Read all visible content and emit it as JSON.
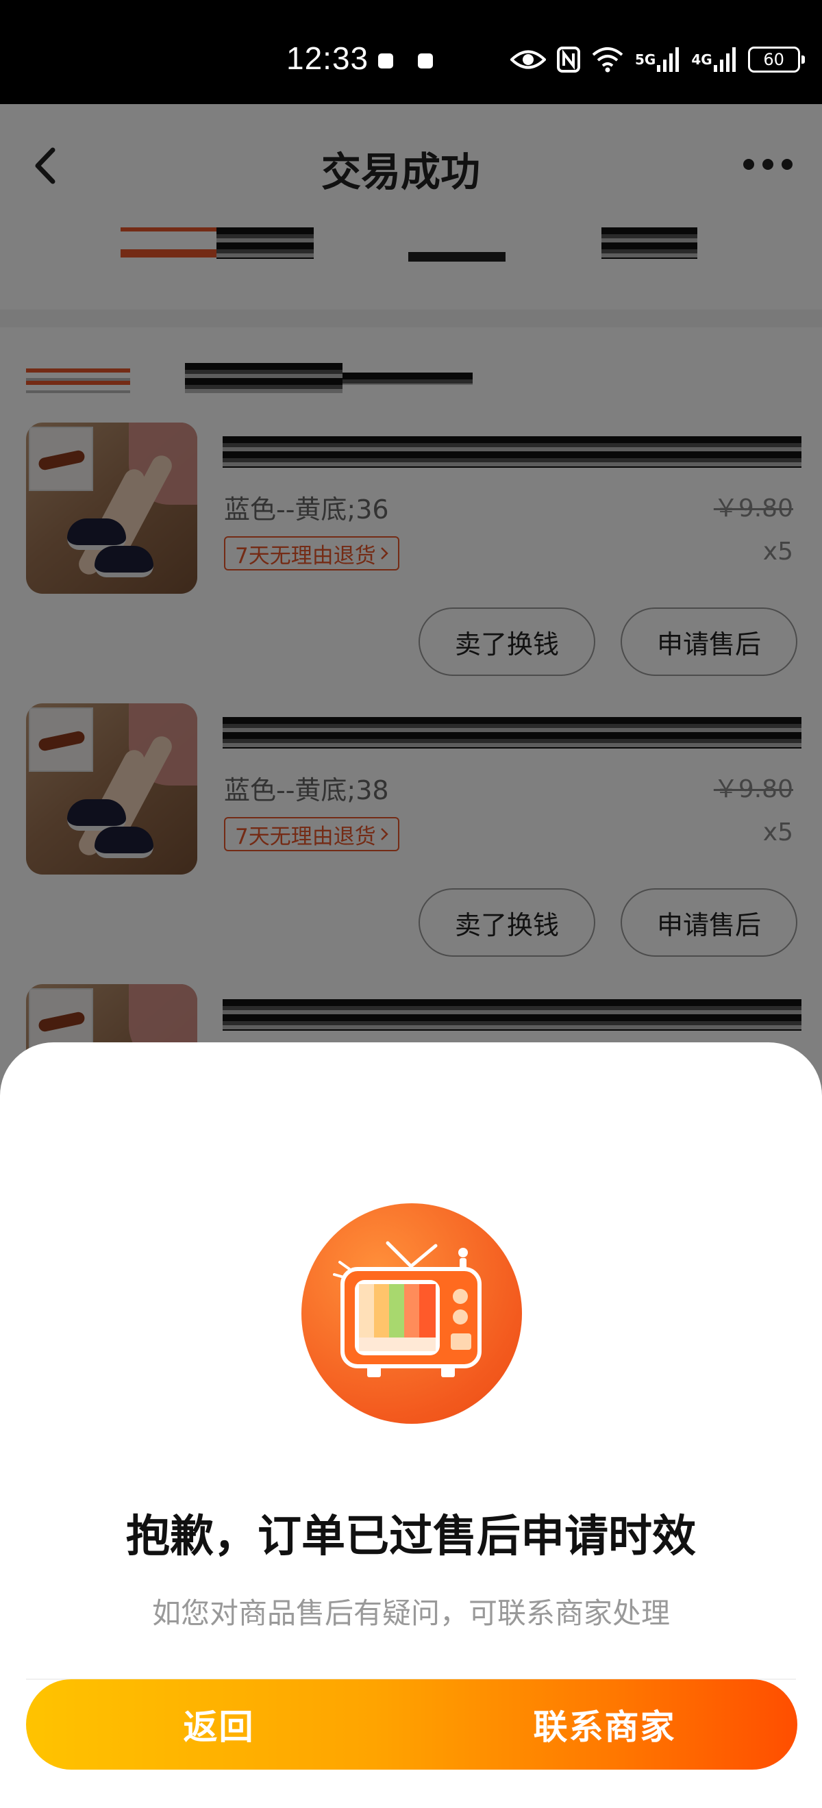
{
  "status_bar": {
    "time": "12:33",
    "battery": "60",
    "network_labels": [
      "5G",
      "4G"
    ]
  },
  "nav": {
    "title": "交易成功"
  },
  "products": [
    {
      "variant": "蓝色--黄底;36",
      "price": "￥9.80",
      "quantity": "x5",
      "return_badge": "7天无理由退货",
      "sell_label": "卖了换钱",
      "aftersale_label": "申请售后"
    },
    {
      "variant": "蓝色--黄底;38",
      "price": "￥9.80",
      "quantity": "x5",
      "return_badge": "7天无理由退货",
      "sell_label": "卖了换钱",
      "aftersale_label": "申请售后"
    }
  ],
  "dialog": {
    "title": "抱歉，订单已过售后申请时效",
    "subtitle": "如您对商品售后有疑问，可联系商家处理",
    "back_label": "返回",
    "contact_label": "联系商家"
  },
  "colors": {
    "accent_orange": "#e8572a",
    "button_gradient_start": "#ffc300",
    "button_gradient_end": "#ff4e00"
  }
}
